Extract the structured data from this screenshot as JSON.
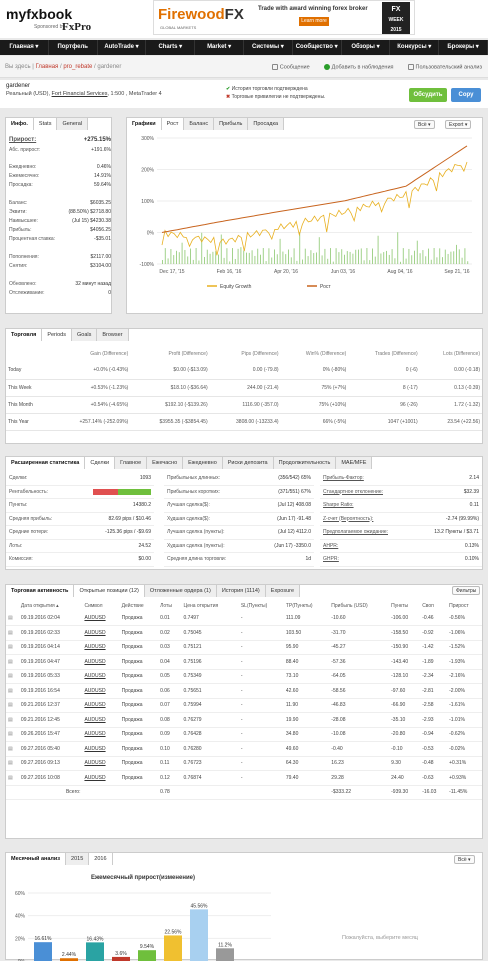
{
  "header": {
    "logo_main": "myfxbook",
    "sponsor": "Sponsored by",
    "sponsor_brand": "FxPro",
    "banner": {
      "brand_a": "Firewood",
      "brand_b": "FX",
      "tag": "GLOBAL MARKETS",
      "tagline": "Trade with award winning forex broker",
      "cta": "Learn more",
      "award_a": "FX",
      "award_b": "WEEK",
      "award_c": "2015"
    }
  },
  "nav": [
    "Главная ▾",
    "Портфель",
    "AutoTrade ▾",
    "Charts ▾",
    "Market ▾",
    "Системы ▾",
    "Сообщество ▾",
    "Обзоры ▾",
    "Конкурсы ▾",
    "Брокеры ▾"
  ],
  "breadcrumb": {
    "prefix": "Вы здесь | ",
    "home": "Главная",
    "sep1": " / ",
    "section": "pro_rebate",
    "sep2": " / ",
    "current": "gardener"
  },
  "actions": {
    "message": "Сообщение",
    "watch": "Добавить в наблюдения",
    "report": "Пользовательский анализ"
  },
  "account": {
    "name": "gardener",
    "type": "Реальный (USD), ",
    "broker": "Fort Financial Services",
    "rest": ", 1:500 , MetaTrader 4",
    "verify1": "История торговли подтверждена",
    "verify2": "Торговые привилегии не подтверждены.",
    "discuss": "Обсудить",
    "copy": "Copy",
    "colors": {
      "discuss": "#6fbf3c",
      "copy": "#4a8fd6"
    }
  },
  "info": {
    "tab_info": "Инфо.",
    "tab_stats": "Stats",
    "tab_general": "General",
    "rows": [
      {
        "k": "Прирост:",
        "v": "+275.15%",
        "cls": "g",
        "big": true
      },
      {
        "k": "Абс. прирост:",
        "v": "+191.6%",
        "cls": "g"
      },
      {
        "k": "Ежедневно:",
        "v": "0.46%"
      },
      {
        "k": "Ежемесячно:",
        "v": "14.91%"
      },
      {
        "k": "Просадка:",
        "v": "59.64%"
      },
      {
        "k": "Баланс:",
        "v": "$6035.25"
      },
      {
        "k": "Эквити:",
        "v": "(88.50%) $2718.80"
      },
      {
        "k": "Наивысшее:",
        "v": "(Jul 15) $4230.38"
      },
      {
        "k": "Прибыль:",
        "v": "$4056.25"
      },
      {
        "k": "Процентная ставка:",
        "v": "-$35.01"
      },
      {
        "k": "Пополнения:",
        "v": "$2117.00"
      },
      {
        "k": "Снятия:",
        "v": "$3104.00"
      },
      {
        "k": "Обновлено:",
        "v": "32 минут назад"
      },
      {
        "k": "Отслеживание:",
        "v": "0"
      }
    ]
  },
  "chart": {
    "tab_charts": "Графики",
    "tab_growth": "Рост",
    "tab_balance": "Баланс",
    "tab_profit": "Прибыль",
    "tab_drawdown": "Просадка",
    "sel_all": "Всё ▾",
    "export": "Export ▾",
    "ylabels": [
      "300%",
      "200%",
      "100%",
      "0%",
      "-100%"
    ],
    "xlabels": [
      "Dec 17, '15",
      "Feb 16, '16",
      "Apr 20, '16",
      "Jun 03, '16",
      "Aug 04, '16",
      "Sep 21, '16"
    ],
    "legend_equity": "Equity Growth",
    "legend_growth": "Рост",
    "colors": {
      "growth": "#c8641e",
      "equity": "#e8b020",
      "bars": "#7abf5a"
    }
  },
  "chart_data": {
    "type": "line",
    "x": [
      "Dec 17, '15",
      "Feb 16, '16",
      "Apr 20, '16",
      "Jun 03, '16",
      "Aug 04, '16",
      "Sep 21, '16"
    ],
    "ylim": [
      -100,
      300
    ],
    "series": [
      {
        "name": "Рост",
        "values": [
          0,
          36,
          69,
          101,
          147,
          275
        ]
      },
      {
        "name": "Equity Growth",
        "values": [
          0,
          -30,
          20,
          65,
          120,
          230
        ]
      }
    ]
  },
  "trading": {
    "title": "Торговля",
    "tab_periods": "Periods",
    "tab_goals": "Goals",
    "tab_browser": "Browser",
    "headers": [
      "Gain (Difference)",
      "Profit (Difference)",
      "Pips (Difference)",
      "Win% (Difference)",
      "Trades (Difference)",
      "Lots (Difference)"
    ],
    "rows": [
      {
        "p": "Today",
        "c": [
          "+0.0% (-0.43%)",
          "$0.00 (-$13.09)",
          "0.00 (-79.8)",
          "0% (-80%)",
          "0 (-6)",
          "0.00 (-0.18)"
        ],
        "k": [
          "g",
          "",
          "",
          "",
          "",
          ""
        ]
      },
      {
        "p": "This Week",
        "c": [
          "+0.53% (-1.23%)",
          "$18.10 (-$36.64)",
          "244.00 (-21.4)",
          "75% (+7%)",
          "8 (-17)",
          "0.13 (-0.39)"
        ],
        "k": [
          "g",
          "g",
          "g",
          "g",
          "",
          ""
        ]
      },
      {
        "p": "This Month",
        "c": [
          "+0.54% (-4.65%)",
          "$192.10 (-$139.26)",
          "1116.90 (-357.0)",
          "75% (+10%)",
          "96 (-26)",
          "1.72 (-1.32)"
        ],
        "k": [
          "g",
          "g",
          "g",
          "g",
          "",
          ""
        ]
      },
      {
        "p": "This Year",
        "c": [
          "+257.14% (-252.09%)",
          "$3955.35 (-$3854.45)",
          "3808.00 (-13233.4)",
          "66% (-5%)",
          "1047 (+1001)",
          "23.54 (+22.56)"
        ],
        "k": [
          "g",
          "g",
          "g",
          "",
          "",
          ""
        ]
      }
    ]
  },
  "ext": {
    "title": "Расширенная статистика",
    "tabs": [
      "Сделки",
      "Главное",
      "Ежечасно",
      "Ежедневно",
      "Риски депозита",
      "Продолжительность",
      "MAE/MFE"
    ],
    "c1": [
      [
        "Сделки:",
        "1093"
      ],
      [
        "Рентабельность:",
        ""
      ],
      [
        "Пункты:",
        "14380.2"
      ],
      [
        "Средняя прибыль:",
        "82.69 pips / $10.46"
      ],
      [
        "Средние потери:",
        "-125.36 pips / -$9.69"
      ],
      [
        "Лоты:",
        "24.52"
      ],
      [
        "Комиссия:",
        "$0.00"
      ]
    ],
    "c2": [
      [
        "Прибыльных длинных:",
        "(356/542) 65%"
      ],
      [
        "Прибыльных коротких:",
        "(371/551) 67%"
      ],
      [
        "Лучшая сделка($):",
        "(Jul 12) 408.08"
      ],
      [
        "Худшая сделка($):",
        "(Jun 17) -91.48"
      ],
      [
        "Лучшая сделка (пункты):",
        "(Jul 12) 4112.0"
      ],
      [
        "Худшая сделка (пункты):",
        "(Jun 17) -3350.0"
      ],
      [
        "Средняя длина торговли:",
        "1d"
      ]
    ],
    "c3": [
      [
        "Прибыль-Фактор:",
        "2.14"
      ],
      [
        "Стандартное отклонение:",
        "$32.39"
      ],
      [
        "Sharpe Ratio:",
        "0.11"
      ],
      [
        "Z-счет (Вероятность):",
        "-2.74 (99.99%)"
      ],
      [
        "Предполагаемое ожидание:",
        "13.2 Пункты / $3.71"
      ],
      [
        "AHPR:",
        "0.13%"
      ],
      [
        "GHPR:",
        "0.10%"
      ]
    ]
  },
  "activity": {
    "title": "Торговая активность",
    "tabs": [
      "Открытые позиции (12)",
      "Отложенные ордера (1)",
      "История (1114)",
      "Exposure"
    ],
    "filter": "Фильтры",
    "headers": [
      "Дата открытия ▴",
      "Символ",
      "Действие",
      "Лоты",
      "Цена открытия",
      "SL(Пункты)",
      "TP(Пункты)",
      "Прибыль (USD)",
      "Пункты",
      "Своп",
      "Прирост"
    ],
    "rows": [
      [
        "09.19.2016 02:04",
        "AUDUSD",
        "Продажа",
        "0.01",
        "0.7497",
        "-",
        "111.09",
        "-10.60",
        "-106.00",
        "-0.46",
        "-0.56%"
      ],
      [
        "09.19.2016 02:33",
        "AUDUSD",
        "Продажа",
        "0.02",
        "0.75045",
        "-",
        "103.50",
        "-31.70",
        "-158.50",
        "-0.92",
        "-1.06%"
      ],
      [
        "09.19.2016 04:14",
        "AUDUSD",
        "Продажа",
        "0.03",
        "0.75121",
        "-",
        "95.90",
        "-45.27",
        "-150.90",
        "-1.42",
        "-1.52%"
      ],
      [
        "09.19.2016 04:47",
        "AUDUSD",
        "Продажа",
        "0.04",
        "0.75196",
        "-",
        "88.40",
        "-57.36",
        "-143.40",
        "-1.89",
        "-1.93%"
      ],
      [
        "09.19.2016 05:33",
        "AUDUSD",
        "Продажа",
        "0.05",
        "0.75349",
        "-",
        "73.10",
        "-64.05",
        "-128.10",
        "-2.34",
        "-2.16%"
      ],
      [
        "09.19.2016 16:54",
        "AUDUSD",
        "Продажа",
        "0.06",
        "0.75651",
        "-",
        "42.60",
        "-58.56",
        "-97.60",
        "-2.81",
        "-2.00%"
      ],
      [
        "09.21.2016 12:37",
        "AUDUSD",
        "Продажа",
        "0.07",
        "0.75994",
        "-",
        "11.90",
        "-46.83",
        "-66.90",
        "-2.58",
        "-1.61%"
      ],
      [
        "09.21.2016 12:45",
        "AUDUSD",
        "Продажа",
        "0.08",
        "0.76279",
        "-",
        "19.90",
        "-28.08",
        "-35.10",
        "-2.93",
        "-1.01%"
      ],
      [
        "09.26.2016 15:47",
        "AUDUSD",
        "Продажа",
        "0.09",
        "0.76428",
        "-",
        "34.80",
        "-10.08",
        "-20.80",
        "-0.94",
        "-0.62%"
      ],
      [
        "09.27.2016 05:40",
        "AUDUSD",
        "Продажа",
        "0.10",
        "0.76280",
        "-",
        "49.60",
        "-0.40",
        "-0.10",
        "-0.53",
        "-0.02%"
      ],
      [
        "09.27.2016 09:13",
        "AUDUSD",
        "Продажа",
        "0.11",
        "0.76723",
        "-",
        "64.30",
        "16.23",
        "9.30",
        "-0.48",
        "+0.31%"
      ],
      [
        "09.27.2016 10:08",
        "AUDUSD",
        "Продажа",
        "0.12",
        "0.76874",
        "-",
        "79.40",
        "29.28",
        "24.40",
        "-0.63",
        "+0.93%"
      ]
    ],
    "total_label": "Всего:",
    "total_lots": "0.78",
    "total_profit": "-$333.22",
    "total_pips": "-939.30",
    "total_swap": "-16.03",
    "total_gain": "-11.45%"
  },
  "monthly": {
    "title": "Месячный анализ",
    "tab1": "2015",
    "tab2": "2016",
    "sel": "Всё ▾",
    "chart_title": "Ежемесячный прирост(изменение)",
    "ylabels": [
      "60%",
      "40%",
      "20%",
      "0%"
    ],
    "placeholder": "Пожалуйста, выберите месяц",
    "bar_labels": [
      "16.61%",
      "2.44%",
      "16.43%",
      "3.6%",
      "9.54%",
      "22.56%",
      "45.56%",
      "11.2%"
    ],
    "bar_values": [
      16.61,
      2.44,
      16.43,
      3.6,
      9.54,
      22.56,
      45.56,
      11.2
    ],
    "bar_colors": [
      "#4a8fd6",
      "#e07000",
      "#2aa3a3",
      "#c0392b",
      "#6fbf3c",
      "#f0c030",
      "#a8d0f0",
      "#999999"
    ]
  }
}
